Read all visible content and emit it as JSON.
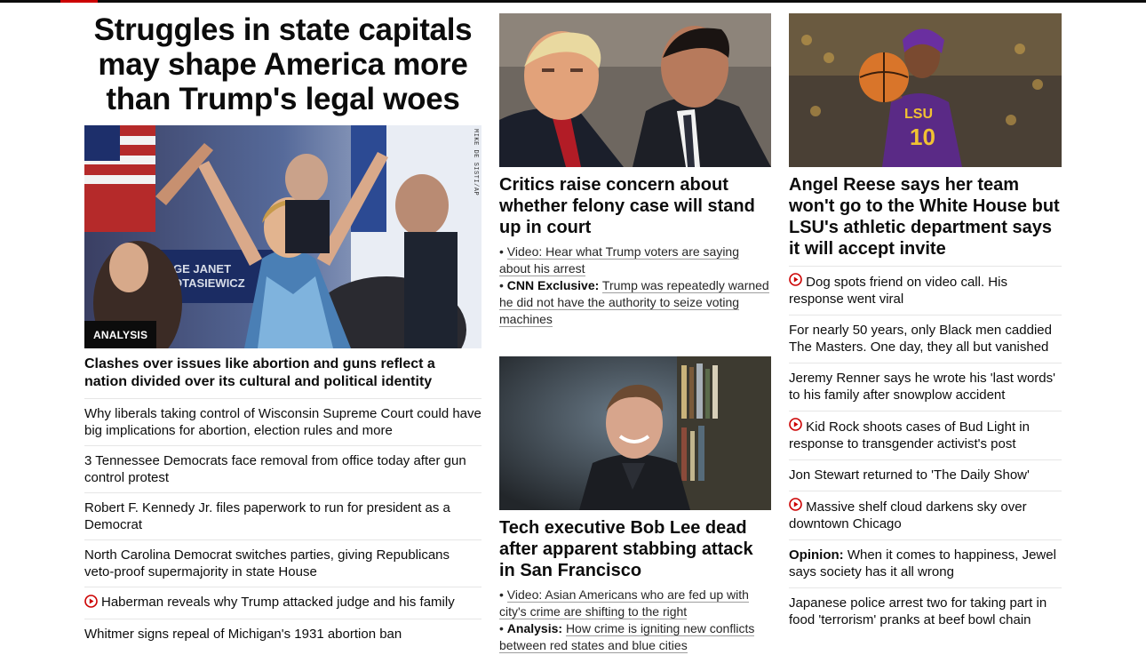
{
  "colors": {
    "accent": "#cc0000",
    "text": "#0c0c0c",
    "divider": "#e6e6e6"
  },
  "left": {
    "headline": "Struggles in state capitals may shape America more than Trump's legal woes",
    "image_credit": "MIKE DE SISTI/AP",
    "badge": "ANALYSIS",
    "image_sign_text": "GE JANET\nOTASIEWICZ",
    "subhead": "Clashes over issues like abortion and guns reflect a nation divided over its cultural and political identity",
    "items": [
      {
        "text": "Why liberals taking control of Wisconsin Supreme Court could have big implications for abortion, election rules and more"
      },
      {
        "text": "3 Tennessee Democrats face removal from office today after gun control protest"
      },
      {
        "text": "Robert F. Kennedy Jr. files paperwork to run for president as a Democrat"
      },
      {
        "text": "North Carolina Democrat switches parties, giving Republicans veto-proof supermajority in state House"
      },
      {
        "text": "Haberman reveals why Trump attacked judge and his family",
        "icon": "play-icon"
      },
      {
        "text": "Whitmer signs repeal of Michigan's 1931 abortion ban"
      }
    ]
  },
  "mid": {
    "story1": {
      "headline": "Critics raise concern about whether felony case will stand up in court",
      "b1_text": "Video: Hear what Trump voters are saying about his arrest",
      "b2_label": "CNN Exclusive:",
      "b2_text": "Trump was repeatedly warned he did not have the authority to seize voting machines"
    },
    "story2": {
      "headline": "Tech executive Bob Lee dead after apparent stabbing attack in San Francisco",
      "b1_text": "Video: Asian Americans who are fed up with city's crime are shifting to the right",
      "b2_label": "Analysis:",
      "b2_text": "How crime is igniting new conflicts between red states and blue cities"
    }
  },
  "right": {
    "headline": "Angel Reese says her team won't go to the White House but LSU's athletic department says it will accept invite",
    "jersey": "LSU",
    "jersey_number": "10",
    "items": [
      {
        "text": "Dog spots friend on video call. His response went viral",
        "icon": "play-icon"
      },
      {
        "text": "For nearly 50 years, only Black men caddied The Masters. One day, they all but vanished"
      },
      {
        "text": "Jeremy Renner says he wrote his 'last words' to his family after snowplow accident"
      },
      {
        "text": "Kid Rock shoots cases of Bud Light in response to transgender activist's post",
        "icon": "play-icon"
      },
      {
        "text": "Jon Stewart returned to 'The Daily Show'"
      },
      {
        "text": "Massive shelf cloud darkens sky over downtown Chicago",
        "icon": "play-icon"
      },
      {
        "label": "Opinion:",
        "text": "When it comes to happiness, Jewel says society has it all wrong"
      },
      {
        "text": "Japanese police arrest two for taking part in food 'terrorism' pranks at beef bowl chain"
      }
    ]
  }
}
